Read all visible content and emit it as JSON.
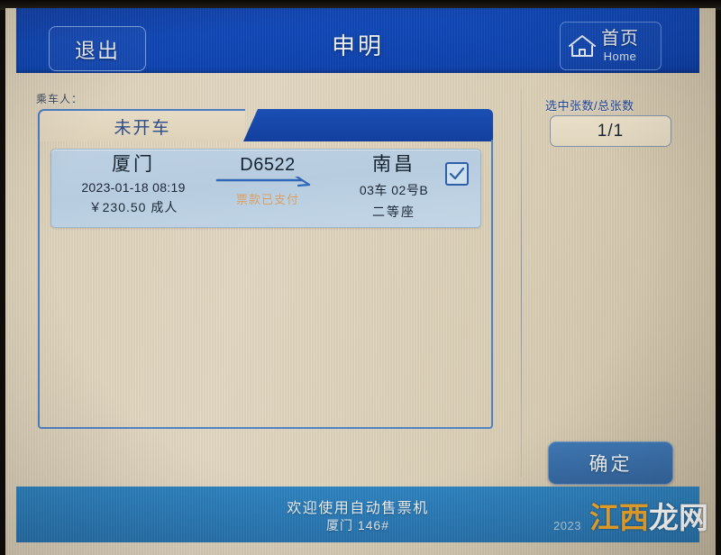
{
  "header": {
    "exit_label": "退出",
    "title": "申明",
    "home_cn": "首页",
    "home_en": "Home",
    "icon": "home-icon"
  },
  "main": {
    "passenger_label": "乘车人：",
    "tabs": [
      {
        "label": "未开车",
        "active": true
      }
    ],
    "ticket": {
      "from_city": "厦门",
      "datetime": "2023-01-18 08:19",
      "price": "￥230.50 成人",
      "train_no": "D6522",
      "paid_status": "票款已支付",
      "to_city": "南昌",
      "seat": "03车 02号B",
      "seat_class": "二等座",
      "selected": true,
      "checkbox_icon": "check-icon"
    }
  },
  "sidebar": {
    "count_label": "选中张数/总张数",
    "count_value": "1/1",
    "confirm_label": "确定"
  },
  "footer": {
    "welcome": "欢迎使用自动售票机",
    "station": "厦门 146#",
    "date": "2023",
    "watermark_a": "江西",
    "watermark_b": "龙网"
  },
  "colors": {
    "header_blue": "#124aba",
    "footer_blue": "#2d7fbd",
    "panel_beige": "#ded2ba",
    "ticket_blue": "#b7cddf",
    "accent_orange": "#d9a068",
    "border_blue": "#5182c2",
    "button_blue": "#3a6fa9",
    "watermark_orange": "#f0a82c"
  }
}
